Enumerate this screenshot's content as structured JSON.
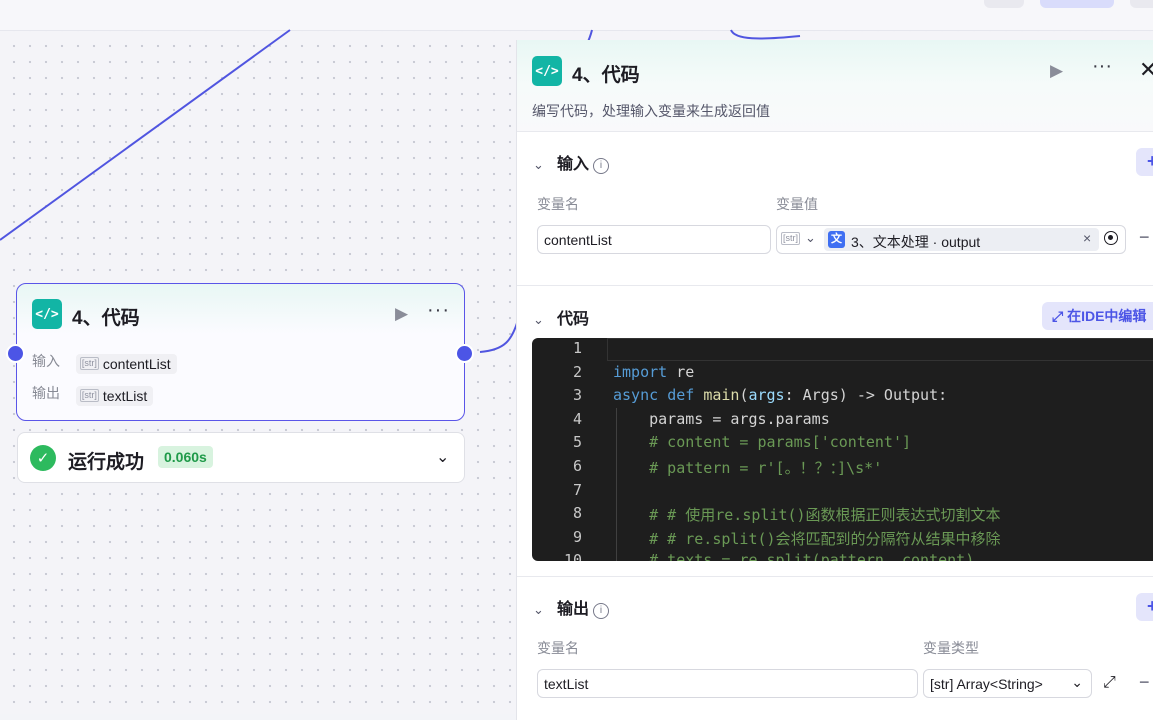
{
  "colors": {
    "accent": "#4c55e6",
    "code_icon_bg": "#12b5a5",
    "success": "#2dba5e"
  },
  "node": {
    "icon": "code-icon",
    "title": "4、代码",
    "input_label": "输入",
    "input_type": "[str]",
    "input_value": "contentList",
    "output_label": "输出",
    "output_type": "[str]",
    "output_value": "textList"
  },
  "run_status": {
    "label": "运行成功",
    "duration": "0.060s"
  },
  "panel": {
    "title": "4、代码",
    "description": "编写代码，处理输入变量来生成返回值",
    "input_section": {
      "title": "输入",
      "col_name": "变量名",
      "col_value": "变量值",
      "var_name": "contentList",
      "value_type": "[str]",
      "value_ref": "3、文本处理 · output",
      "plus": "+"
    },
    "code_section": {
      "title": "代码",
      "ide_button": "在IDE中编辑",
      "lines": [
        {
          "n": "1",
          "t": ""
        },
        {
          "n": "2",
          "t": "import re"
        },
        {
          "n": "3",
          "t": "async def main(args: Args) -> Output:"
        },
        {
          "n": "4",
          "t": "    params = args.params"
        },
        {
          "n": "5",
          "t": "    # content = params['content']"
        },
        {
          "n": "6",
          "t": "    # pattern = r'[。！？：]\\s*'"
        },
        {
          "n": "7",
          "t": ""
        },
        {
          "n": "8",
          "t": "    # # 使用re.split()函数根据正则表达式切割文本"
        },
        {
          "n": "9",
          "t": "    # # re.split()会将匹配到的分隔符从结果中移除"
        },
        {
          "n": "10",
          "t": "    # texts = re.split(pattern, content)"
        }
      ]
    },
    "output_section": {
      "title": "输出",
      "col_name": "变量名",
      "col_type": "变量类型",
      "var_name": "textList",
      "type_label": "[str] Array<String>",
      "plus": "+"
    }
  }
}
